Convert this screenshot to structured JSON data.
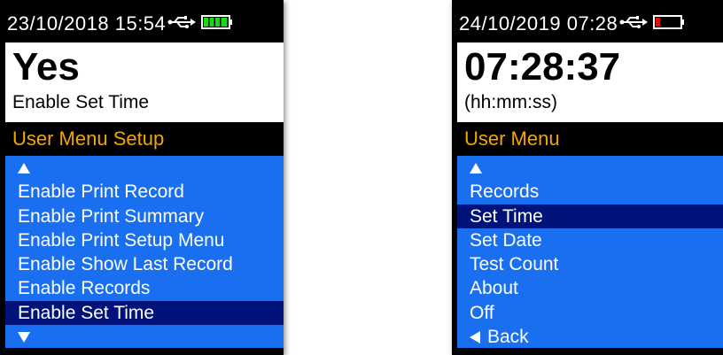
{
  "left_screen": {
    "status": {
      "datetime": "23/10/2018  15:54",
      "usb_icon": "usb-icon",
      "battery_icon": "battery-full-icon",
      "battery_color": "#18d818",
      "battery_level": 1.0
    },
    "value_panel": {
      "value": "Yes",
      "label": "Enable Set Time"
    },
    "menu_title": "User Menu Setup",
    "menu_items": [
      "Enable Print Record",
      "Enable Print Summary",
      "Enable Print Setup Menu",
      "Enable Show Last Record",
      "Enable Records",
      "Enable Set Time"
    ],
    "selected_item": "Enable Set Time",
    "scroll_up_icon": "arrow-up-icon",
    "scroll_down_icon": "arrow-down-icon"
  },
  "right_screen": {
    "status": {
      "datetime": "24/10/2019 07:28",
      "usb_icon": "usb-icon",
      "battery_icon": "battery-low-icon",
      "battery_color": "#e01010",
      "battery_level": 0.15
    },
    "value_panel": {
      "value": "07:28:37",
      "label": "(hh:mm:ss)"
    },
    "menu_title": "User Menu",
    "menu_items": [
      "Records",
      "Set Time",
      "Set Date",
      "Test Count",
      "About",
      "Off"
    ],
    "selected_item": "Set Time",
    "back_label": "Back",
    "scroll_up_icon": "arrow-up-icon",
    "back_icon": "arrow-left-icon"
  },
  "colors": {
    "menu_bg": "#1a6ff0",
    "selected_bg": "#00137a",
    "title_color": "#f5a500"
  }
}
